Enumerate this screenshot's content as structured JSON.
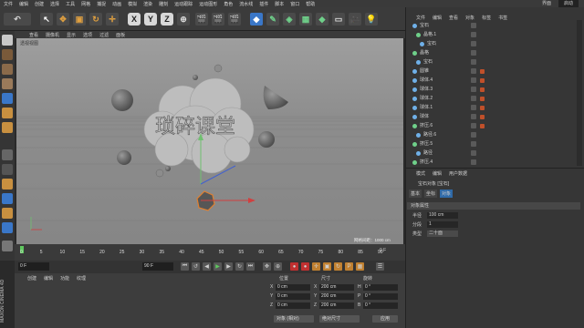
{
  "menubar": {
    "items": [
      "文件",
      "编辑",
      "创建",
      "选择",
      "工具",
      "网格",
      "捕捉",
      "动画",
      "模拟",
      "渲染",
      "雕刻",
      "运动跟踪",
      "运动图形",
      "角色",
      "流水线",
      "插件",
      "脚本",
      "窗口",
      "帮助"
    ],
    "right": [
      "界面",
      "启动"
    ]
  },
  "toolbar": {
    "x_label": "X",
    "y_label": "Y",
    "z_label": "Z"
  },
  "viewport": {
    "menu": [
      "查看",
      "摄像机",
      "显示",
      "选项",
      "过滤",
      "面板"
    ],
    "label": "透视视图",
    "grid_info": "网格间距：1000 cm",
    "text_art": "琐碎课堂"
  },
  "timeline": {
    "ticks": [
      "0",
      "5",
      "10",
      "15",
      "20",
      "25",
      "30",
      "35",
      "40",
      "45",
      "50",
      "55",
      "60",
      "65",
      "70",
      "75",
      "80",
      "85",
      "90"
    ],
    "current_frame": "0 F",
    "start_field": "0 F",
    "end_field": "90 F"
  },
  "material_panel": {
    "tabs": [
      "创建",
      "编辑",
      "功能",
      "纹理"
    ],
    "brand": "MAXON CINEMA 4D"
  },
  "coordinates": {
    "headers": [
      "位置",
      "尺寸",
      "旋转"
    ],
    "rows": [
      {
        "axis": "X",
        "pos": "0 cm",
        "size_axis": "X",
        "size": "200 cm",
        "rot_axis": "H",
        "rot": "0 °"
      },
      {
        "axis": "Y",
        "pos": "0 cm",
        "size_axis": "Y",
        "size": "200 cm",
        "rot_axis": "P",
        "rot": "0 °"
      },
      {
        "axis": "Z",
        "pos": "0 cm",
        "size_axis": "Z",
        "size": "200 cm",
        "rot_axis": "B",
        "rot": "0 °"
      }
    ],
    "mode1": "对象 (相对)",
    "mode2": "绝对尺寸",
    "apply": "应用"
  },
  "object_manager": {
    "tabs": [
      "文件",
      "编辑",
      "查看",
      "对象",
      "标签",
      "书签"
    ],
    "objects": [
      {
        "name": "宝石",
        "color": "#6fb0e8"
      },
      {
        "name": "晶格.1",
        "color": "#6fd08a"
      },
      {
        "name": "宝石",
        "color": "#6fb0e8"
      },
      {
        "name": "晶格",
        "color": "#6fd08a"
      },
      {
        "name": "宝石",
        "color": "#6fb0e8"
      },
      {
        "name": "圆锥",
        "color": "#6fb0e8"
      },
      {
        "name": "球体.4",
        "color": "#6fb0e8"
      },
      {
        "name": "球体.3",
        "color": "#6fb0e8"
      },
      {
        "name": "球体.2",
        "color": "#6fb0e8"
      },
      {
        "name": "球体.1",
        "color": "#6fb0e8"
      },
      {
        "name": "球体",
        "color": "#6fb0e8"
      },
      {
        "name": "挤压.6",
        "color": "#6fd08a"
      },
      {
        "name": "路径.6",
        "color": "#6fb0e8"
      },
      {
        "name": "挤压.5",
        "color": "#6fd08a"
      },
      {
        "name": "路径",
        "color": "#6fb0e8"
      },
      {
        "name": "挤压.4",
        "color": "#6fd08a"
      }
    ]
  },
  "attribute_manager": {
    "tabs": [
      "模式",
      "编辑",
      "用户数据"
    ],
    "title": "宝石对象 [宝石]",
    "subtabs": [
      "基本",
      "坐标",
      "对象"
    ],
    "section": "对象属性",
    "props": [
      {
        "label": "半径",
        "value": "100 cm"
      },
      {
        "label": "分段",
        "value": "1"
      },
      {
        "label": "类型",
        "value": "二十面"
      }
    ]
  }
}
